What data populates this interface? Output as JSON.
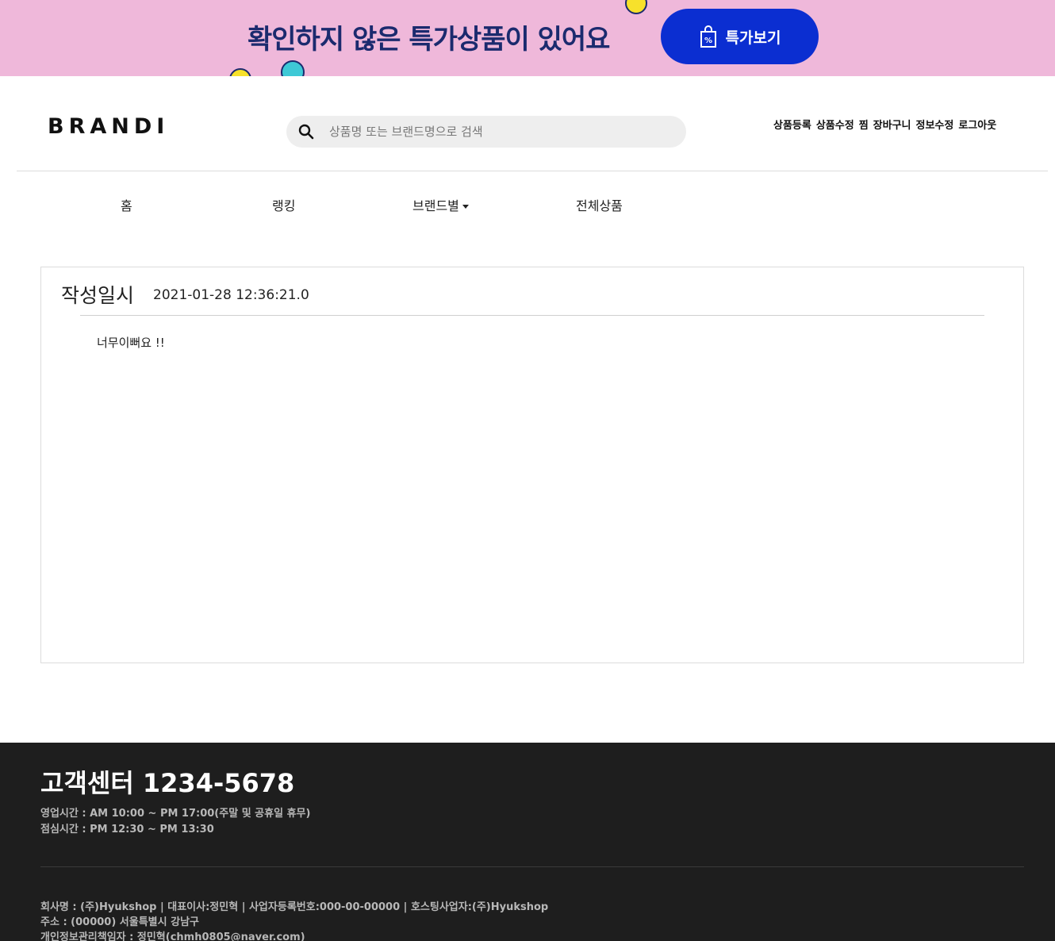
{
  "banner": {
    "text": "확인하지 않은 특가상품이 있어요",
    "button_label": "특가보기",
    "background_color": "#efb8da",
    "button_color": "#0b2ed1",
    "text_color": "#1b2a6e"
  },
  "header": {
    "logo": "BRANDI",
    "search_placeholder": "상품명 또는 브랜드명으로 검색",
    "user_menu": [
      "상품등록",
      "상품수정",
      "찜",
      "장바구니",
      "정보수정",
      "로그아웃"
    ]
  },
  "nav": {
    "home": "홈",
    "ranking": "랭킹",
    "brand": "브랜드별",
    "all_products": "전체상품"
  },
  "review": {
    "date_label": "작성일시",
    "date_value": "2021-01-28 12:36:21.0",
    "content": "너무이뻐요 !!"
  },
  "footer": {
    "title": "고객센터 1234-5678",
    "hours": [
      "영업시간 : AM 10:00 ~ PM 17:00(주말 및 공휴일 휴무)",
      "점심시간 : PM 12:30 ~ PM 13:30"
    ],
    "company": [
      "회사명 : (주)Hyukshop | 대표이사:정민혁 | 사업자등록번호:000-00-00000 | 호스팅사업자:(주)Hyukshop",
      "주소 : (00000) 서울특별시 강남구",
      "개인정보관리책임자 : 정민혁(chmh0805@naver.com)"
    ],
    "background_color": "#1e1e1e"
  }
}
